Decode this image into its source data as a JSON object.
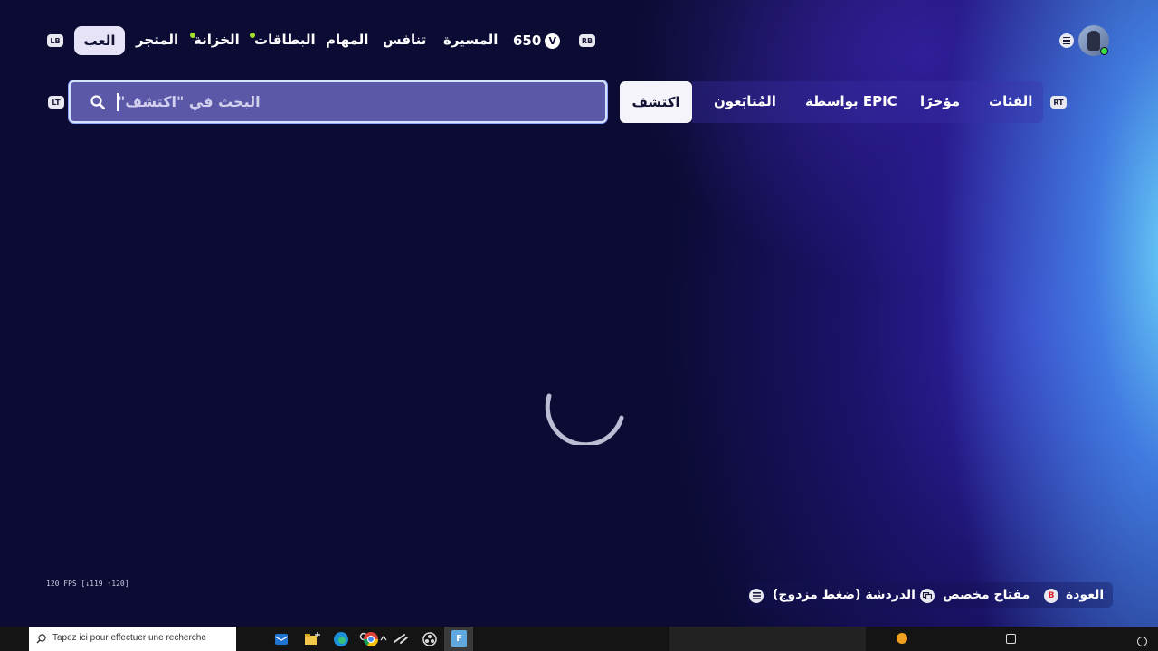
{
  "header": {
    "kb_left": "LB",
    "kb_right": "RB",
    "tabs": {
      "play": "العب",
      "shop": "المتجر",
      "locker": "الخزانة",
      "cards": "البطاقات",
      "quests": "المهام",
      "compete": "تنافس",
      "career": "المسيرة"
    },
    "vbucks": "650",
    "vbucks_icon_letter": "V",
    "notification_dot_color": "#a6e22e"
  },
  "discover_bar": {
    "kb_left": "LT",
    "kb_right": "RT",
    "search_placeholder": "البحث في \"اكتشف\"",
    "tabs": {
      "discover": "اكتشف",
      "followed": "المُتابَعون",
      "by_epic": "بواسطة EPIC",
      "recent": "مؤخرًا",
      "categories": "الفئات"
    }
  },
  "footer": {
    "fps": "120 FPS [↓119 ↑120]",
    "back_key": "B",
    "back": "العودة",
    "custom_key": "مفتاح مخصص",
    "chat": "الدردشة (ضغط مزدوج)"
  },
  "taskbar": {
    "search_text": "Tapez ici pour effectuer une recherche",
    "fortnite_letter": "F"
  },
  "colors": {
    "accent_background": "#0b0b33",
    "selected_tab": "#e6e3f7",
    "search_field": "#5b58a8",
    "back_button": "#e02030",
    "online_status": "#3ddc3d"
  },
  "icons": [
    "menu-icon",
    "avatar",
    "search-icon",
    "loading-spinner",
    "chat-icon",
    "custom-key-icon",
    "windows-search-icon",
    "outlook-icon",
    "file-explorer-icon",
    "edge-icon",
    "chrome-icon",
    "steam-icon",
    "obs-icon",
    "fortnite-icon"
  ]
}
